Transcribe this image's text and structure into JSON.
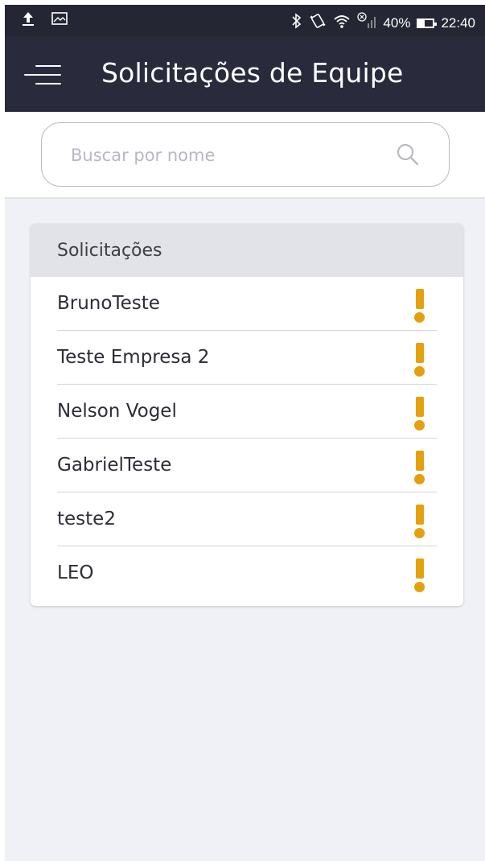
{
  "status_bar": {
    "battery": "40%",
    "time": "22:40",
    "icons": [
      "upload-icon",
      "image-icon",
      "bluetooth-icon",
      "vibrate-icon",
      "wifi-icon",
      "signal-icon",
      "battery-icon"
    ]
  },
  "app_bar": {
    "title": "Solicitações de Equipe",
    "background": "#292b3d"
  },
  "search": {
    "placeholder": "Buscar por nome",
    "value": ""
  },
  "requests": {
    "header": "Solicitações",
    "accent": "#e5a00d",
    "items": [
      {
        "name": "BrunoTeste"
      },
      {
        "name": "Teste Empresa 2"
      },
      {
        "name": "Nelson Vogel"
      },
      {
        "name": "GabrielTeste"
      },
      {
        "name": "teste2"
      },
      {
        "name": "LEO"
      }
    ]
  }
}
